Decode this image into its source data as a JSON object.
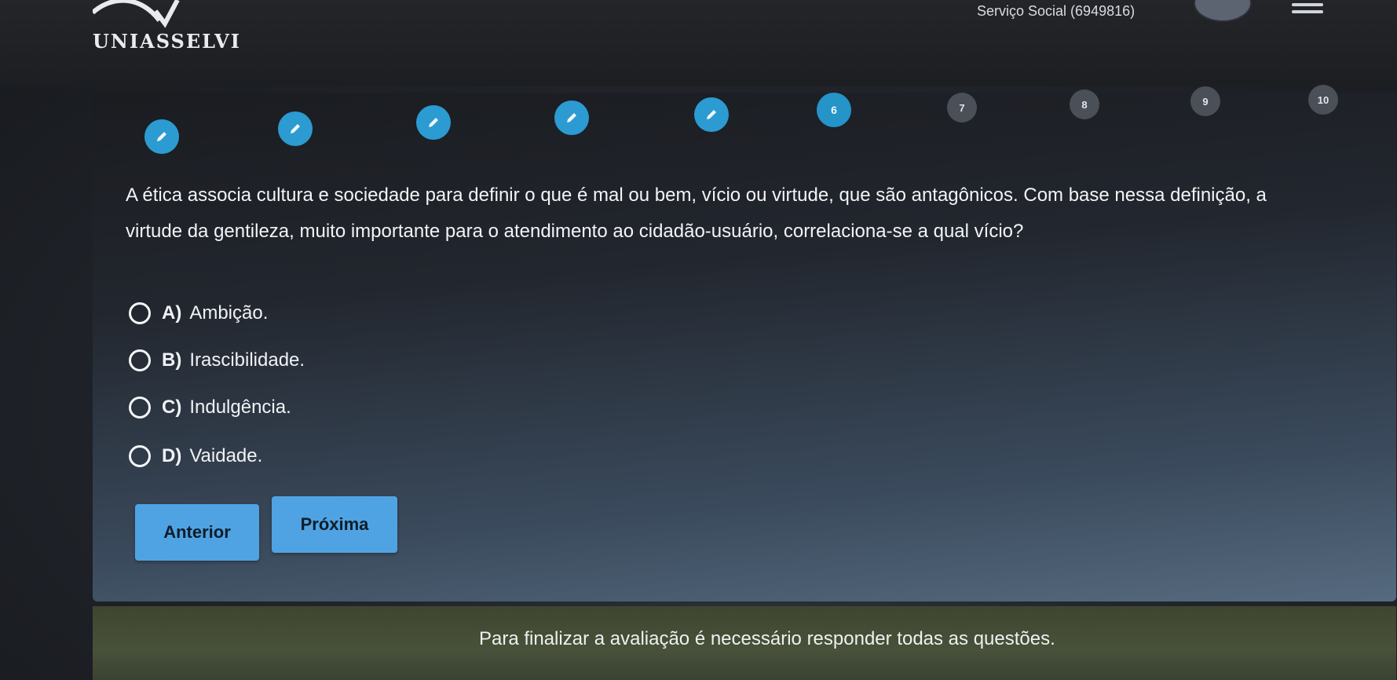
{
  "header": {
    "brand": "UNIASSELVI",
    "user_label": "Serviço Social (6949816)"
  },
  "progress": {
    "steps": [
      {
        "label": "",
        "state": "answered",
        "icon": "pencil-icon"
      },
      {
        "label": "",
        "state": "answered",
        "icon": "pencil-icon"
      },
      {
        "label": "",
        "state": "answered",
        "icon": "pencil-icon"
      },
      {
        "label": "",
        "state": "answered",
        "icon": "pencil-icon"
      },
      {
        "label": "",
        "state": "answered",
        "icon": "pencil-icon"
      },
      {
        "label": "6",
        "state": "current"
      },
      {
        "label": "7",
        "state": "pending"
      },
      {
        "label": "8",
        "state": "pending"
      },
      {
        "label": "9",
        "state": "pending"
      },
      {
        "label": "10",
        "state": "pending"
      }
    ]
  },
  "question": {
    "line1": "A ética associa cultura e sociedade para definir o que é mal ou bem, vício ou virtude, que são antagônicos. Com base nessa definição, a",
    "line2": "virtude da gentileza, muito importante para o atendimento ao cidadão-usuário, correlaciona-se a qual vício?"
  },
  "options": [
    {
      "letter": "A)",
      "text": "Ambição."
    },
    {
      "letter": "B)",
      "text": "Irascibilidade."
    },
    {
      "letter": "C)",
      "text": "Indulgência."
    },
    {
      "letter": "D)",
      "text": "Vaidade."
    }
  ],
  "buttons": {
    "previous": "Anterior",
    "next": "Próxima"
  },
  "notice": "Para finalizar a avaliação é necessário responder todas as questões.",
  "colors": {
    "accent": "#2b9bd2",
    "button": "#4fa3e3",
    "notice_bg": "#48513a"
  }
}
